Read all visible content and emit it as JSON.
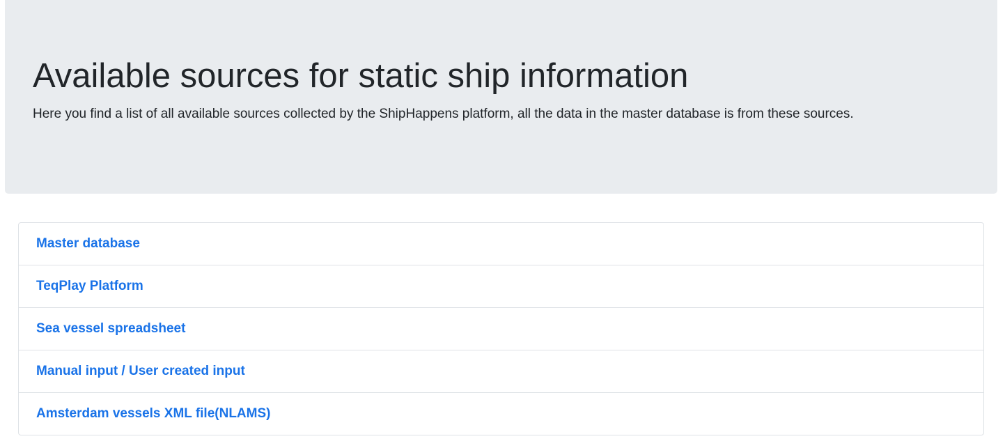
{
  "header": {
    "title": "Available sources for static ship information",
    "lead": "Here you find a list of all available sources collected by the ShipHappens platform, all the data in the master database is from these sources."
  },
  "sources": {
    "items": [
      {
        "label": "Master database"
      },
      {
        "label": "TeqPlay Platform"
      },
      {
        "label": "Sea vessel spreadsheet"
      },
      {
        "label": "Manual input / User created input"
      },
      {
        "label": "Amsterdam vessels XML file(NLAMS)"
      }
    ]
  },
  "colors": {
    "jumbotron_bg": "#e9ecef",
    "link": "#1a73e8",
    "border": "#dee2e6",
    "text": "#212529"
  }
}
